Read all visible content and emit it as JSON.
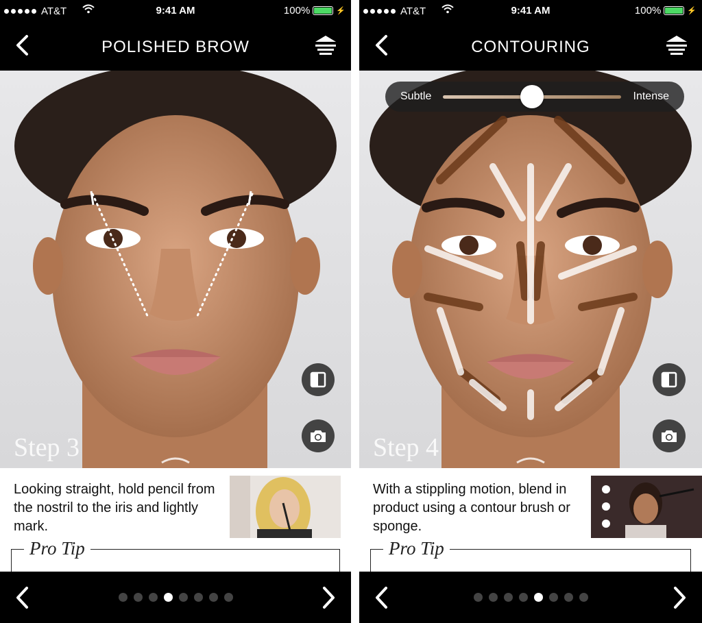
{
  "status_bar": {
    "carrier": "AT&T",
    "time": "9:41 AM",
    "battery": "100%"
  },
  "screens": [
    {
      "title": "POLISHED BROW",
      "step_label": "Step 3",
      "description": "Looking straight, hold pencil from the nostril to the iris and lightly mark.",
      "pro_tip": "Pro Tip",
      "page_count": 8,
      "active_page": 4
    },
    {
      "title": "CONTOURING",
      "step_label": "Step 4",
      "description": "With a stippling motion, blend in product using a contour brush or sponge.",
      "pro_tip": "Pro Tip",
      "slider": {
        "min_label": "Subtle",
        "max_label": "Intense",
        "value": 0.5
      },
      "page_count": 8,
      "active_page": 5
    }
  ],
  "icons": {
    "back": "chevron-left-icon",
    "menu": "stacked-menu-icon",
    "compare": "split-compare-icon",
    "camera": "camera-icon",
    "swipe": "chevron-up-icon",
    "prev": "chevron-left-icon",
    "next": "chevron-right-icon"
  },
  "colors": {
    "background": "#000000",
    "battery": "#4cd964",
    "dot_active": "#ffffff",
    "dot_inactive": "#444444"
  }
}
